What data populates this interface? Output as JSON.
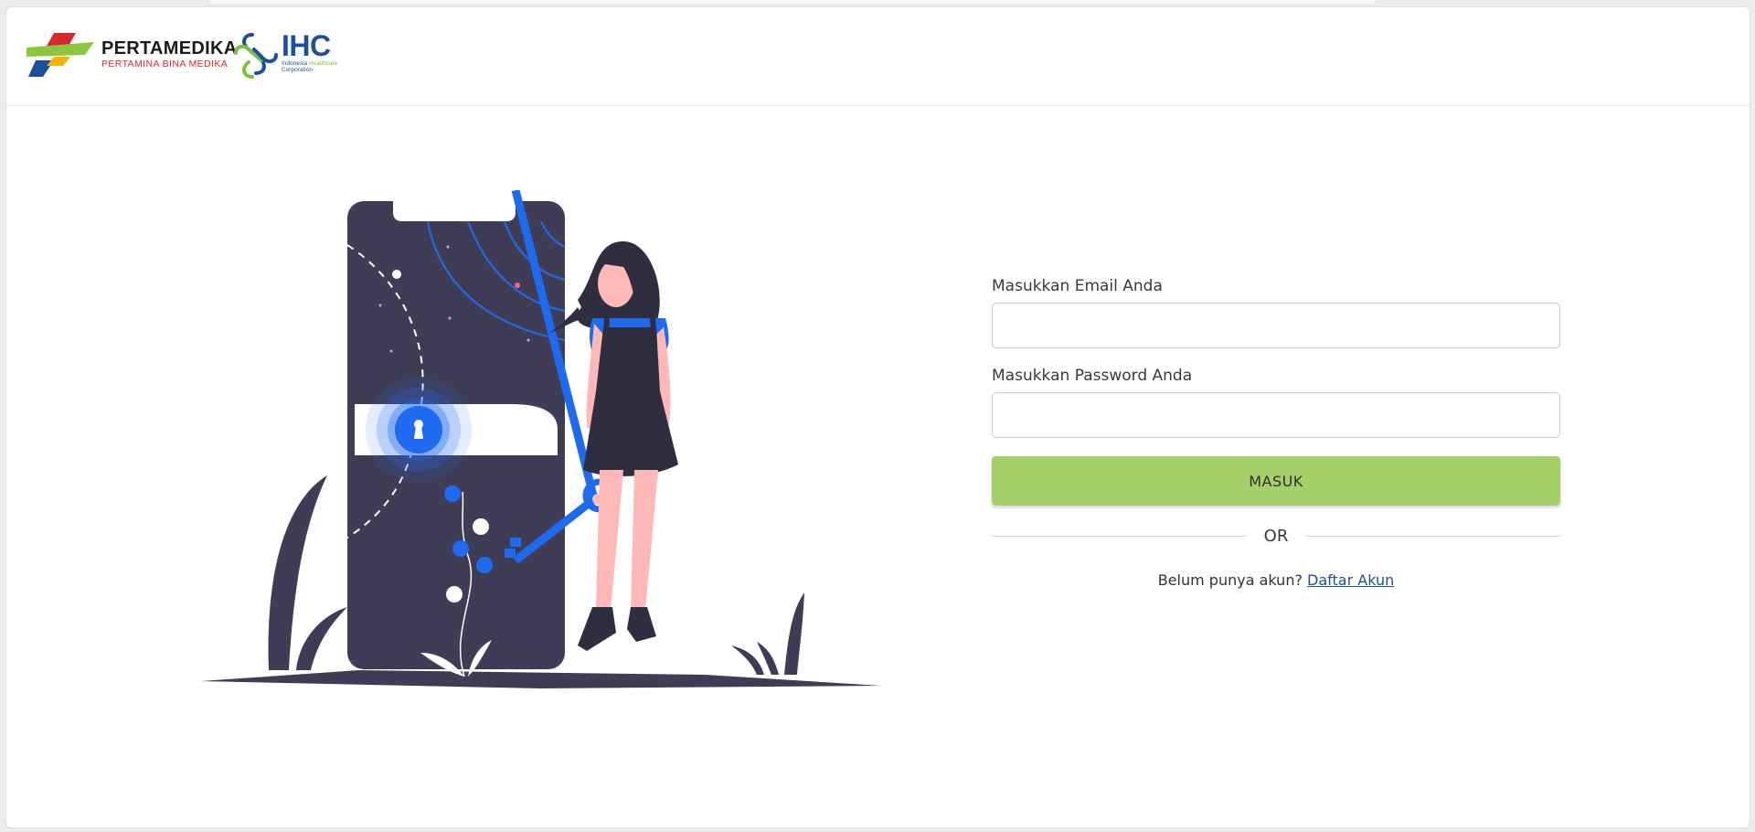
{
  "header": {
    "pertamedika_name": "PERTAMEDIKA",
    "pertamedika_sub": "PERTAMINA BINA MEDIKA",
    "ihc_name": "IHC",
    "ihc_sub_1": "Indonesia",
    "ihc_sub_2": "Healthcare",
    "ihc_sub_3": "Corporation"
  },
  "form": {
    "email_label": "Masukkan Email Anda",
    "email_value": "",
    "password_label": "Masukkan Password Anda",
    "password_value": "",
    "submit_label": "MASUK",
    "divider_label": "OR",
    "register_prompt": "Belum punya akun?",
    "register_link": "Daftar Akun"
  },
  "colors": {
    "button": "#a6d16a",
    "link": "#1c4f9c",
    "illustration_dark": "#3f3d56",
    "illustration_accent": "#1f6bf0",
    "skin": "#ffb8b8"
  },
  "icons": [
    "pertamedika-logo-icon",
    "ihc-logo-icon",
    "keyhole-icon",
    "key-icon"
  ]
}
